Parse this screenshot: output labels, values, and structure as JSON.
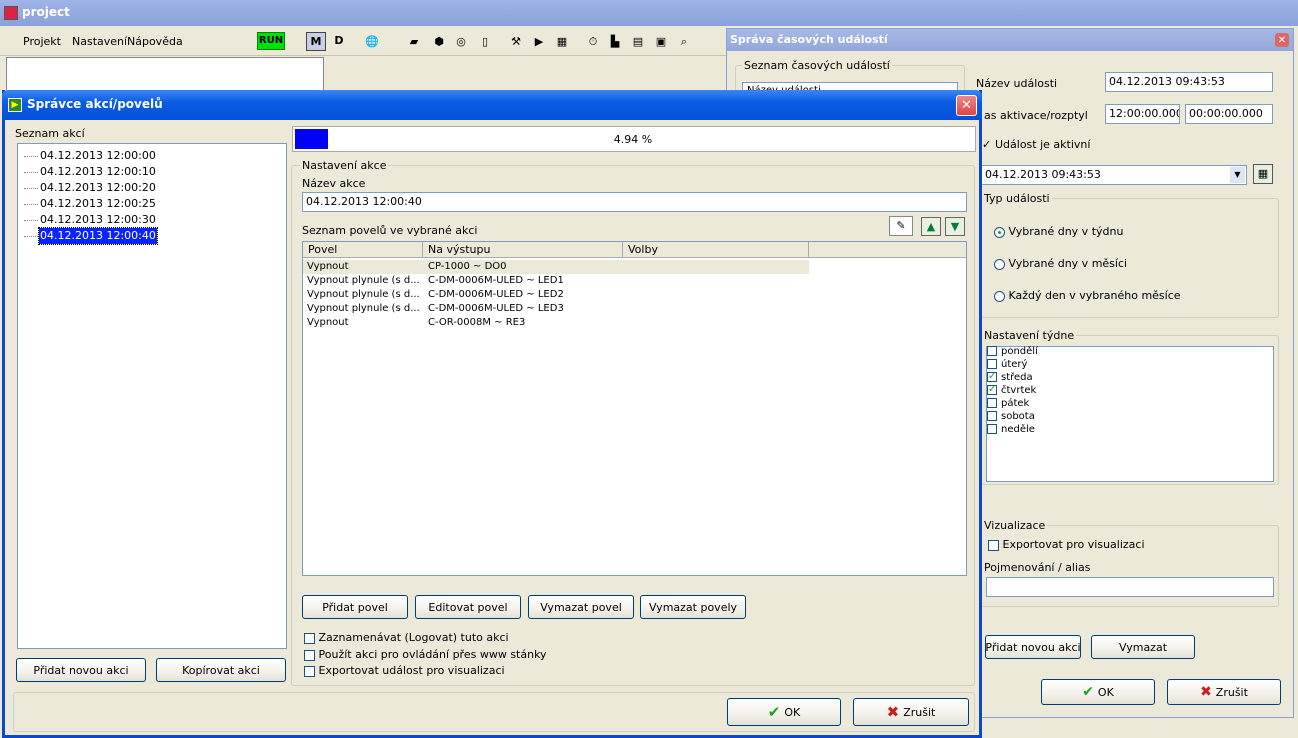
{
  "main_window": {
    "title": "project",
    "menu": [
      "Projekt",
      "Nastavení",
      "Nápověda"
    ],
    "run_label": "RUN",
    "mode_m": "M",
    "mode_d": "D"
  },
  "events_dialog": {
    "title": "Správa časových událostí",
    "list_group": "Seznam časových událostí",
    "list_header": "Název události",
    "name_label": "Název události",
    "name_value": "04.12.2013 09:43:53",
    "time_label": "as aktivace/rozptyl",
    "time_value": "12:00:00.000",
    "spread_value": "00:00:00.000",
    "active_label": "Událost je aktivní",
    "date_value": "04.12.2013 09:43:53",
    "type_group": "Typ události",
    "type_options": [
      "Vybrané dny v týdnu",
      "Vybrané dny v měsíci",
      "Každý den v vybraného měsíce"
    ],
    "week_group": "Nastavení týdne",
    "days": [
      {
        "label": "pondělí",
        "checked": false
      },
      {
        "label": "úterý",
        "checked": false
      },
      {
        "label": "středa",
        "checked": true
      },
      {
        "label": "čtvrtek",
        "checked": true
      },
      {
        "label": "pátek",
        "checked": false
      },
      {
        "label": "sobota",
        "checked": false
      },
      {
        "label": "neděle",
        "checked": false
      }
    ],
    "vis_group": "Vizualizace",
    "export_label": "Exportovat pro visualizaci",
    "alias_label": "Pojmenování / alias",
    "add_action": "Přidat novou akci",
    "delete": "Vymazat",
    "ok": "OK",
    "cancel": "Zrušit"
  },
  "actions_dialog": {
    "title": "Správce akcí/povelů",
    "list_label": "Seznam akcí",
    "actions": [
      "04.12.2013 12:00:00",
      "04.12.2013 12:00:10",
      "04.12.2013 12:00:20",
      "04.12.2013 12:00:25",
      "04.12.2013 12:00:30",
      "04.12.2013 12:00:40"
    ],
    "progress_text": "4.94 %",
    "progress_value": 0.0494,
    "settings_group": "Nastavení akce",
    "name_label": "Název akce",
    "name_value": "04.12.2013 12:00:40",
    "commands_label": "Seznam povelů ve vybrané akci",
    "columns": [
      "Povel",
      "Na výstupu",
      "Volby"
    ],
    "commands": [
      {
        "cmd": "Vypnout",
        "out": "CP-1000 ~ DO0"
      },
      {
        "cmd": "Vypnout plynule (s d...",
        "out": "C-DM-0006M-ULED ~ LED1"
      },
      {
        "cmd": "Vypnout plynule (s d...",
        "out": "C-DM-0006M-ULED ~ LED2"
      },
      {
        "cmd": "Vypnout plynule (s d...",
        "out": "C-DM-0006M-ULED ~ LED3"
      },
      {
        "cmd": "Vypnout",
        "out": "C-OR-0008M ~ RE3"
      }
    ],
    "add_cmd": "Přidat povel",
    "edit_cmd": "Editovat povel",
    "del_cmd": "Vymazat povel",
    "del_cmds": "Vymazat povely",
    "log_label": "Zaznamenávat (Logovat) tuto akci",
    "www_label": "Použít akci pro ovládání přes www stánky",
    "export_label": "Exportovat událost pro visualizaci",
    "add_action": "Přidat novou akci",
    "copy_action": "Kopírovat akci",
    "ok": "OK",
    "cancel": "Zrušit"
  },
  "colors": {
    "title_blue": "#0a5de3",
    "progress": "#0000ff",
    "selection": "#0a24ff",
    "run_bg": "#00e000"
  }
}
